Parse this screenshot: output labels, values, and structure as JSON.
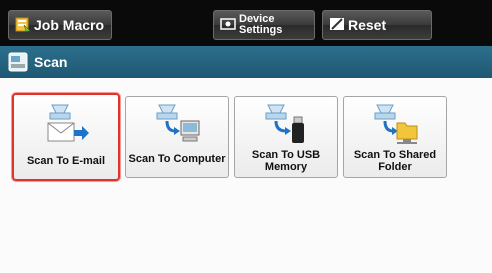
{
  "toolbar": {
    "job_macro_label": "Job Macro",
    "device_settings_line1": "Device",
    "device_settings_line2": "Settings",
    "reset_label": "Reset"
  },
  "header": {
    "title": "Scan"
  },
  "tiles": [
    {
      "label": "Scan To E-mail",
      "icon": "scanner-to-email-icon",
      "selected": true
    },
    {
      "label": "Scan To Computer",
      "icon": "scanner-to-computer-icon",
      "selected": false
    },
    {
      "label_line1": "Scan To USB",
      "label_line2": "Memory",
      "icon": "scanner-to-usb-icon",
      "selected": false
    },
    {
      "label_line1": "Scan To Shared",
      "label_line2": "Folder",
      "icon": "scanner-to-folder-icon",
      "selected": false
    }
  ],
  "colors": {
    "toolbar_bg": "#0a0a0a",
    "header_bg": "#2c6f8c",
    "selection_border": "#e0332c"
  }
}
